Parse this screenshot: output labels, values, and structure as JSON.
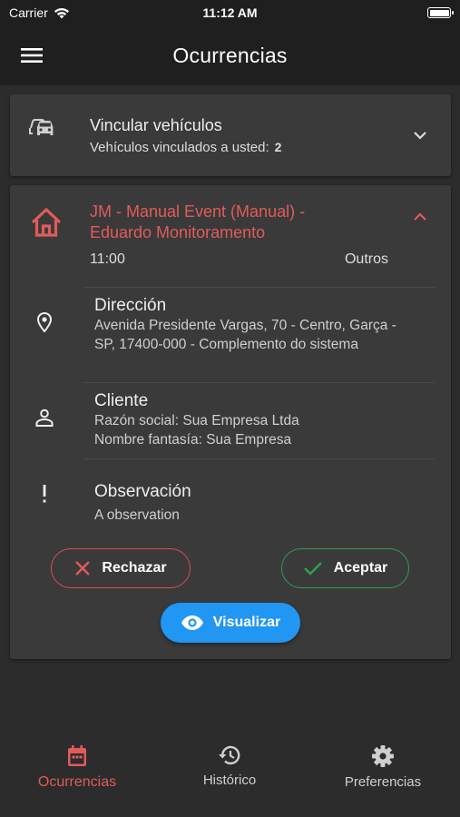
{
  "status_bar": {
    "carrier": "Carrier",
    "time": "11:12 AM"
  },
  "app_bar": {
    "title": "Ocurrencias"
  },
  "vehicles_card": {
    "title": "Vincular vehículos",
    "subtitle": "Vehículos vinculados a usted:",
    "count": "2"
  },
  "event_card": {
    "title": "JM - Manual Event (Manual) - Eduardo Monitoramento",
    "time": "11:00",
    "category": "Outros",
    "address": {
      "title": "Dirección",
      "text": "Avenida Presidente Vargas, 70 - Centro, Garça - SP, 17400-000 - Complemento do sistema"
    },
    "client": {
      "title": "Cliente",
      "line1": "Razón social: Sua Empresa Ltda",
      "line2": "Nombre fantasía: Sua Empresa"
    },
    "observation": {
      "title": "Observación",
      "text": "A observation"
    },
    "reject_label": "Rechazar",
    "accept_label": "Aceptar",
    "view_label": "Visualizar"
  },
  "bottom_nav": {
    "items": [
      {
        "label": "Ocurrencias",
        "icon": "calendar-icon",
        "active": true
      },
      {
        "label": "Histórico",
        "icon": "history-icon",
        "active": false
      },
      {
        "label": "Preferencias",
        "icon": "gear-icon",
        "active": false
      }
    ]
  },
  "colors": {
    "background": "#2c2c2c",
    "app_bar": "#1f1f1f",
    "card": "#3a3a3a",
    "accent_red": "#e15b5b",
    "accept_green": "#2e9e4f",
    "primary_blue": "#2196f3"
  }
}
